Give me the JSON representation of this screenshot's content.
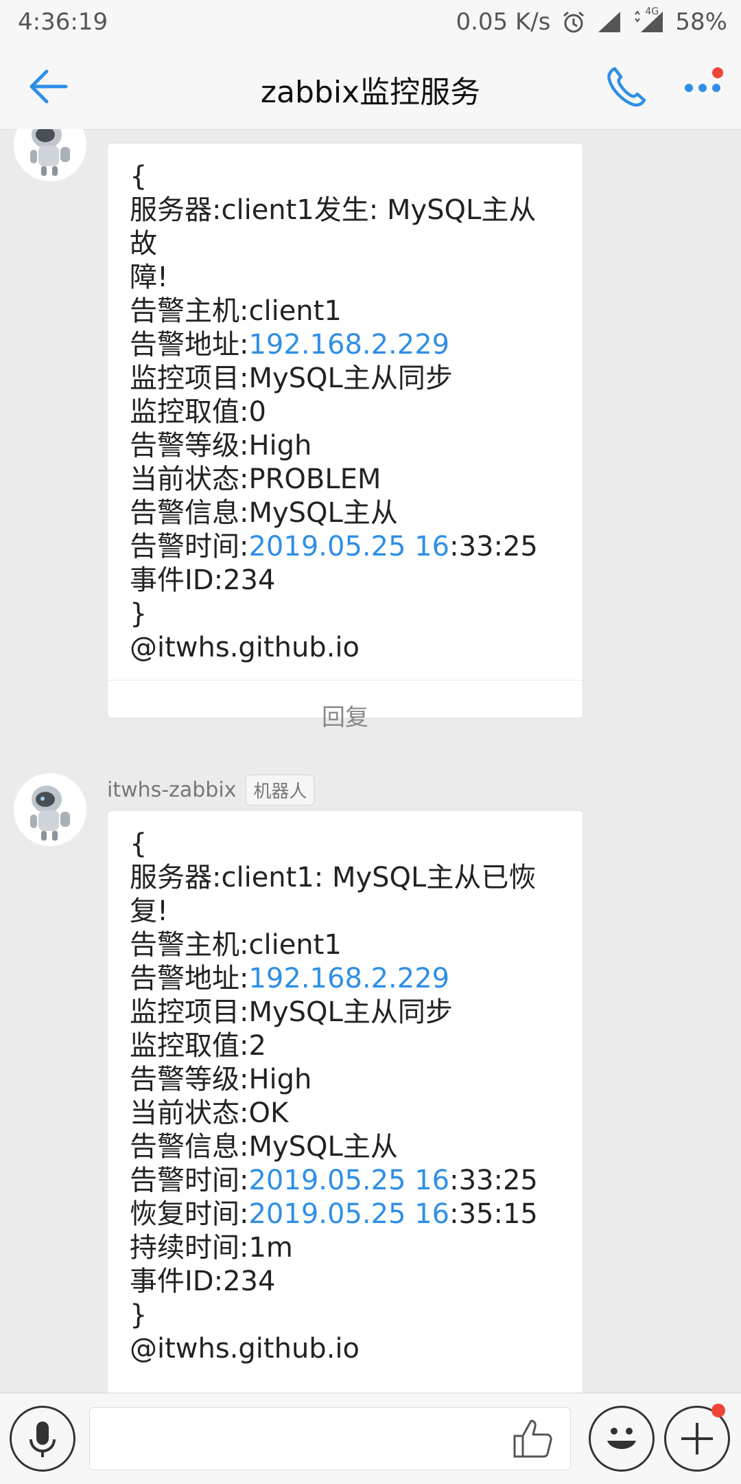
{
  "status_bar": {
    "time": "4:36:19",
    "speed": "0.05 K/s",
    "network": "4G",
    "battery": "58%"
  },
  "header": {
    "title": "zabbix监控服务"
  },
  "messages": [
    {
      "sender": "",
      "badge": "",
      "lines": [
        {
          "parts": [
            {
              "t": "{"
            }
          ]
        },
        {
          "parts": [
            {
              "t": "服务器:client1发生: MySQL主从故"
            }
          ]
        },
        {
          "parts": [
            {
              "t": "障!"
            }
          ]
        },
        {
          "parts": [
            {
              "t": "告警主机:client1"
            }
          ]
        },
        {
          "parts": [
            {
              "t": "告警地址:"
            },
            {
              "t": "192.168.2.229",
              "link": true
            }
          ]
        },
        {
          "parts": [
            {
              "t": "监控项目:MySQL主从同步"
            }
          ]
        },
        {
          "parts": [
            {
              "t": "监控取值:0"
            }
          ]
        },
        {
          "parts": [
            {
              "t": "告警等级:High"
            }
          ]
        },
        {
          "parts": [
            {
              "t": "当前状态:PROBLEM"
            }
          ]
        },
        {
          "parts": [
            {
              "t": "告警信息:MySQL主从"
            }
          ]
        },
        {
          "parts": [
            {
              "t": "告警时间:"
            },
            {
              "t": "2019.05.25 16",
              "link": true
            },
            {
              "t": ":33:25"
            }
          ]
        },
        {
          "parts": [
            {
              "t": "事件ID:234"
            }
          ]
        },
        {
          "parts": [
            {
              "t": "}"
            }
          ]
        },
        {
          "parts": [
            {
              "t": "@itwhs.github.io"
            }
          ]
        }
      ],
      "reply_label": "回复"
    },
    {
      "sender": "itwhs-zabbix",
      "badge": "机器人",
      "lines": [
        {
          "parts": [
            {
              "t": "{"
            }
          ]
        },
        {
          "parts": [
            {
              "t": "服务器:client1: MySQL主从已恢"
            }
          ]
        },
        {
          "parts": [
            {
              "t": "复!"
            }
          ]
        },
        {
          "parts": [
            {
              "t": "告警主机:client1"
            }
          ]
        },
        {
          "parts": [
            {
              "t": "告警地址:"
            },
            {
              "t": "192.168.2.229",
              "link": true
            }
          ]
        },
        {
          "parts": [
            {
              "t": "监控项目:MySQL主从同步"
            }
          ]
        },
        {
          "parts": [
            {
              "t": "监控取值:2"
            }
          ]
        },
        {
          "parts": [
            {
              "t": "告警等级:High"
            }
          ]
        },
        {
          "parts": [
            {
              "t": "当前状态:OK"
            }
          ]
        },
        {
          "parts": [
            {
              "t": "告警信息:MySQL主从"
            }
          ]
        },
        {
          "parts": [
            {
              "t": "告警时间:"
            },
            {
              "t": "2019.05.25 16",
              "link": true
            },
            {
              "t": ":33:25"
            }
          ]
        },
        {
          "parts": [
            {
              "t": "恢复时间:"
            },
            {
              "t": "2019.05.25 16",
              "link": true
            },
            {
              "t": ":35:15"
            }
          ]
        },
        {
          "parts": [
            {
              "t": "持续时间:1m"
            }
          ]
        },
        {
          "parts": [
            {
              "t": "事件ID:234"
            }
          ]
        },
        {
          "parts": [
            {
              "t": "}"
            }
          ]
        },
        {
          "parts": [
            {
              "t": "@itwhs.github.io"
            }
          ]
        }
      ],
      "reply_label": ""
    }
  ],
  "input_bar": {
    "message_value": "",
    "icons": [
      "microphone-icon",
      "thumbs-up-icon",
      "emoji-icon",
      "plus-icon"
    ]
  },
  "colors": {
    "accent": "#2f8fe6",
    "notification_dot": "#f04438",
    "background": "#ebebeb"
  }
}
